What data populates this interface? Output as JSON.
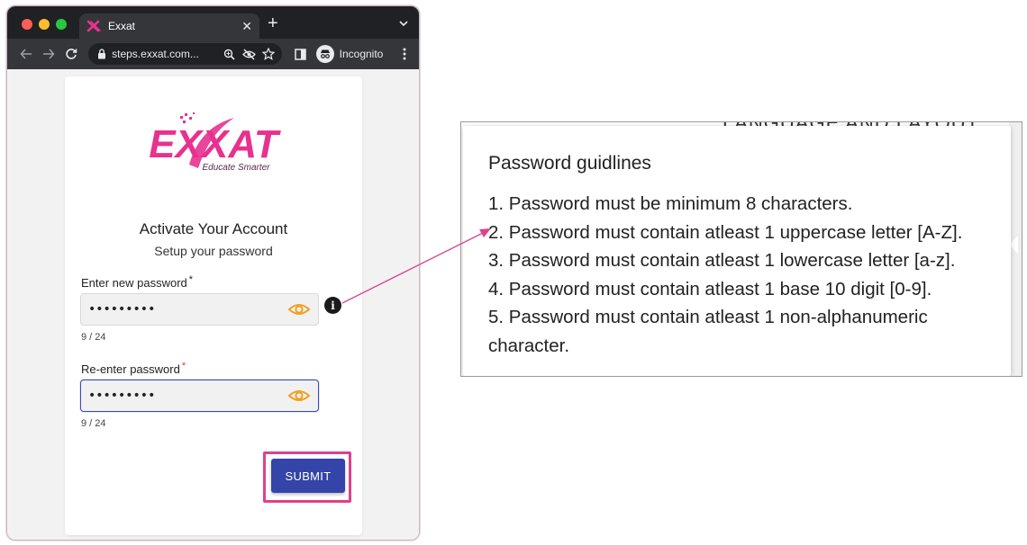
{
  "browser": {
    "tab_title": "Exxat",
    "url": "steps.exxat.com...",
    "incognito_label": "Incognito"
  },
  "brand": {
    "logo_text": "EXXAT",
    "tagline": "Educate Smarter",
    "logo_color": "#e8318f"
  },
  "form": {
    "heading": "Activate Your Account",
    "subheading": "Setup your password",
    "new_password": {
      "label": "Enter new password",
      "required_mark": "*",
      "value": "•••••••••",
      "counter": "9 / 24"
    },
    "confirm_password": {
      "label": "Re-enter password",
      "required_mark": "*",
      "value": "•••••••••",
      "counter": "9 / 24"
    },
    "submit_label": "SUBMIT",
    "accent_color": "#3444a8",
    "highlight_color": "#e0408a"
  },
  "tooltip": {
    "background_text": "LANGUAGE AND LAYOUT",
    "title": "Password guidlines",
    "items": [
      "1. Password must be minimum 8 characters.",
      "2. Password must contain atleast 1 uppercase letter [A-Z].",
      "3. Password must contain atleast 1 lowercase letter [a-z].",
      "4. Password must contain atleast 1 base 10 digit [0-9].",
      "5. Password must contain atleast 1 non-alphanumeric character."
    ]
  }
}
